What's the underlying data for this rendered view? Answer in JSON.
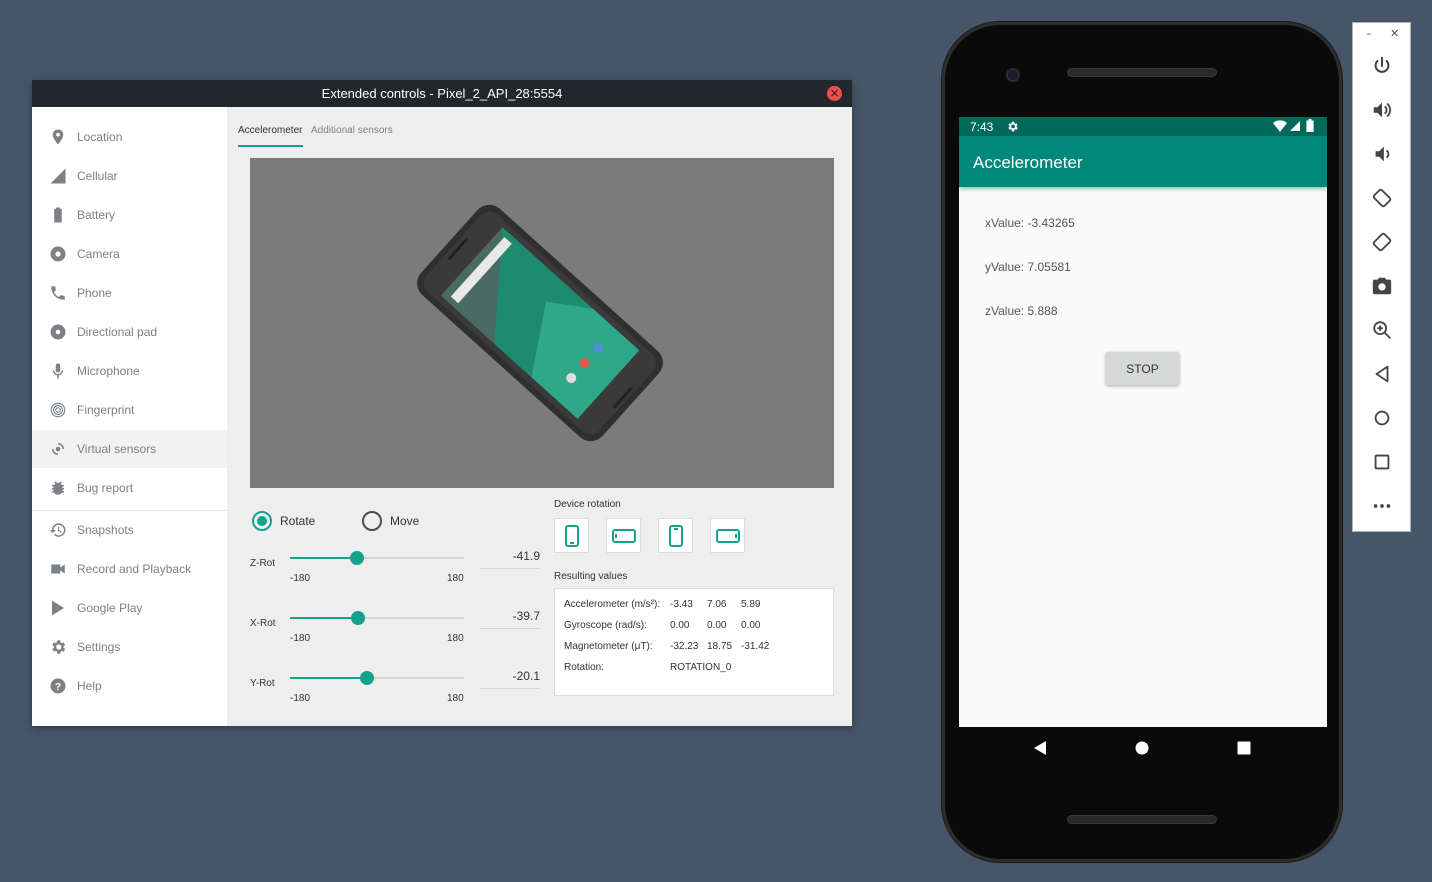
{
  "extended_controls": {
    "title": "Extended controls - Pixel_2_API_28:5554",
    "sidebar": [
      {
        "label": "Location",
        "icon": "location-pin-icon"
      },
      {
        "label": "Cellular",
        "icon": "cellular-signal-icon"
      },
      {
        "label": "Battery",
        "icon": "battery-icon"
      },
      {
        "label": "Camera",
        "icon": "camera-aperture-icon"
      },
      {
        "label": "Phone",
        "icon": "phone-icon"
      },
      {
        "label": "Directional pad",
        "icon": "dpad-icon"
      },
      {
        "label": "Microphone",
        "icon": "microphone-icon"
      },
      {
        "label": "Fingerprint",
        "icon": "fingerprint-icon"
      },
      {
        "label": "Virtual sensors",
        "icon": "virtual-sensors-icon",
        "active": true
      },
      {
        "label": "Bug report",
        "icon": "bug-icon"
      },
      {
        "label": "Snapshots",
        "icon": "history-icon"
      },
      {
        "label": "Record and Playback",
        "icon": "video-camera-icon"
      },
      {
        "label": "Google Play",
        "icon": "google-play-icon"
      },
      {
        "label": "Settings",
        "icon": "gear-icon"
      },
      {
        "label": "Help",
        "icon": "help-icon"
      }
    ],
    "tabs": [
      {
        "label": "Accelerometer",
        "active": true
      },
      {
        "label": "Additional sensors",
        "active": false
      }
    ],
    "mode": {
      "rotate_label": "Rotate",
      "move_label": "Move",
      "selected": "Rotate"
    },
    "sliders": [
      {
        "label": "Z-Rot",
        "min": "-180",
        "max": "180",
        "value": "-41.9",
        "position": -41.9
      },
      {
        "label": "X-Rot",
        "min": "-180",
        "max": "180",
        "value": "-39.7",
        "position": -39.7
      },
      {
        "label": "Y-Rot",
        "min": "-180",
        "max": "180",
        "value": "-20.1",
        "position": -20.1
      }
    ],
    "device_rotation_label": "Device rotation",
    "rotation_buttons": [
      "portrait-icon",
      "landscape-icon",
      "reverse-portrait-icon",
      "reverse-landscape-icon"
    ],
    "resulting_values_label": "Resulting values",
    "results": [
      {
        "label": "Accelerometer (m/s²):",
        "values": [
          "-3.43",
          "7.06",
          "5.89"
        ]
      },
      {
        "label": "Gyroscope (rad/s):",
        "values": [
          "0.00",
          "0.00",
          "0.00"
        ]
      },
      {
        "label": "Magnetometer (μT):",
        "values": [
          "-32.23",
          "18.75",
          "-31.42"
        ]
      },
      {
        "label": "Rotation:",
        "values": [
          "ROTATION_0"
        ]
      }
    ],
    "accent_color": "#14a28c"
  },
  "phone": {
    "status_time": "7:43",
    "app_title": "Accelerometer",
    "values": [
      "xValue: -3.43265",
      "yValue: 7.05581",
      "zValue: 5.888"
    ],
    "stop_label": "STOP",
    "appbar_color": "#00897b",
    "statusbar_color": "#00695c"
  },
  "emulator_toolbar": {
    "window_buttons": [
      "minimize-icon",
      "close-icon"
    ],
    "buttons": [
      "power-icon",
      "volume-up-icon",
      "volume-down-icon",
      "rotate-left-icon",
      "rotate-right-icon",
      "screenshot-icon",
      "zoom-icon",
      "back-icon",
      "home-icon",
      "overview-icon",
      "more-icon"
    ]
  }
}
